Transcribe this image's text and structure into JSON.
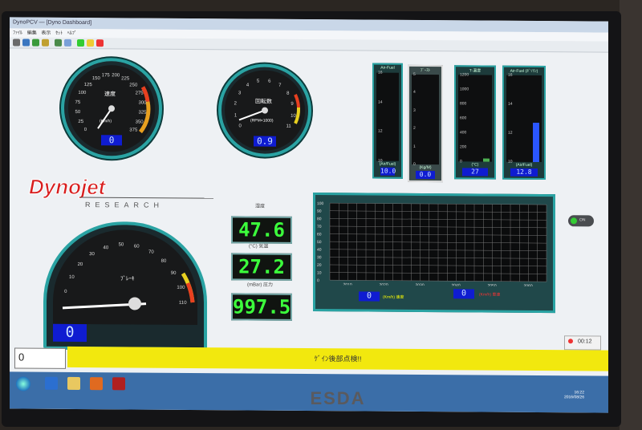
{
  "window": {
    "title": "DynoPCV — [Dyno Dashboard]"
  },
  "menu": [
    "ﾌｧｲﾙ",
    "編集",
    "表示",
    "ｾｯﾄ",
    "ﾍﾙﾌﾟ"
  ],
  "speed_gauge": {
    "label": "速度",
    "unit": "(Km/h)",
    "value": "0",
    "ticks": [
      "0",
      "25",
      "50",
      "75",
      "100",
      "125",
      "150",
      "175",
      "200",
      "225",
      "250",
      "275",
      "300",
      "325",
      "350",
      "375"
    ]
  },
  "rpm_gauge": {
    "label": "回転数",
    "unit": "(RPM×1000)",
    "value": "0.9",
    "ticks": [
      "0",
      "1",
      "2",
      "3",
      "4",
      "5",
      "6",
      "7",
      "8",
      "9",
      "10",
      "11"
    ]
  },
  "bar_gauges": [
    {
      "label": "Air-Fuel",
      "unit": "(Air/Fuel)",
      "value": "10.0",
      "ticks": [
        "16",
        "14",
        "12",
        "10"
      ],
      "fill": 0.0,
      "fill_color": "#2a56ff"
    },
    {
      "label": "ﾌﾞｰｽﾄ",
      "unit": "(Kg/M)",
      "value": "0.0",
      "ticks": [
        "5",
        "4",
        "3",
        "2",
        "1",
        "0"
      ],
      "fill": 0.0,
      "fill_color": "#ffffff"
    },
    {
      "label": "T-温度",
      "unit": "(°C)",
      "value": "27",
      "ticks": [
        "1200",
        "1000",
        "800",
        "600",
        "400",
        "200",
        "0"
      ],
      "fill": 0.04,
      "fill_color": "#4caf50"
    },
    {
      "label": "Air-Fuel (ｶﾞｿﾘﾝ)",
      "unit": "(Air/Fuel)",
      "value": "12.8",
      "ticks": [
        "16",
        "14",
        "12",
        "10"
      ],
      "fill": 0.45,
      "fill_color": "#2a56ff"
    }
  ],
  "logo": {
    "brand": "Dynojet",
    "sub": "RESEARCH"
  },
  "digital_readouts": [
    {
      "label": "湿度",
      "value": "47.6"
    },
    {
      "label": "(°C) 気温",
      "value": "27.2"
    },
    {
      "label": "(mBar) 圧力",
      "value": "997.5"
    }
  ],
  "brake_gauge": {
    "label": "ﾌﾞﾚｰｷ",
    "value": "0",
    "ticks": [
      "0",
      "10",
      "20",
      "30",
      "40",
      "50",
      "60",
      "70",
      "80",
      "90",
      "100",
      "110"
    ]
  },
  "chart": {
    "yticks": [
      "100",
      "90",
      "80",
      "70",
      "60",
      "50",
      "40",
      "30",
      "20",
      "10",
      "0"
    ],
    "xticks": [
      "2010",
      "2020",
      "2030",
      "2040",
      "2050",
      "2060"
    ],
    "readout_left": {
      "value": "0",
      "label": "(Km/h) 速度"
    },
    "readout_right": {
      "value": "0",
      "label": "(Km/h) 車速"
    }
  },
  "chart_data": {
    "type": "line",
    "x": [
      2010,
      2060
    ],
    "series": [],
    "ylim": [
      0,
      100
    ],
    "xlim": [
      2005,
      2065
    ],
    "grid": true
  },
  "toggle": {
    "label": "ON"
  },
  "status": {
    "message": "ｹﾞｲﾝ後部点検!!"
  },
  "spinner": {
    "value": "0"
  },
  "clock": {
    "time": "00:12",
    "tray_time": "16:22",
    "tray_date": "2016/08/26"
  },
  "colors": {
    "accent": "#2aa3a3",
    "status_bar": "#f2e80e",
    "readout": "#0f1cd1",
    "digital_text": "#3cff3c"
  },
  "monitor": {
    "brand": "ESDA"
  }
}
